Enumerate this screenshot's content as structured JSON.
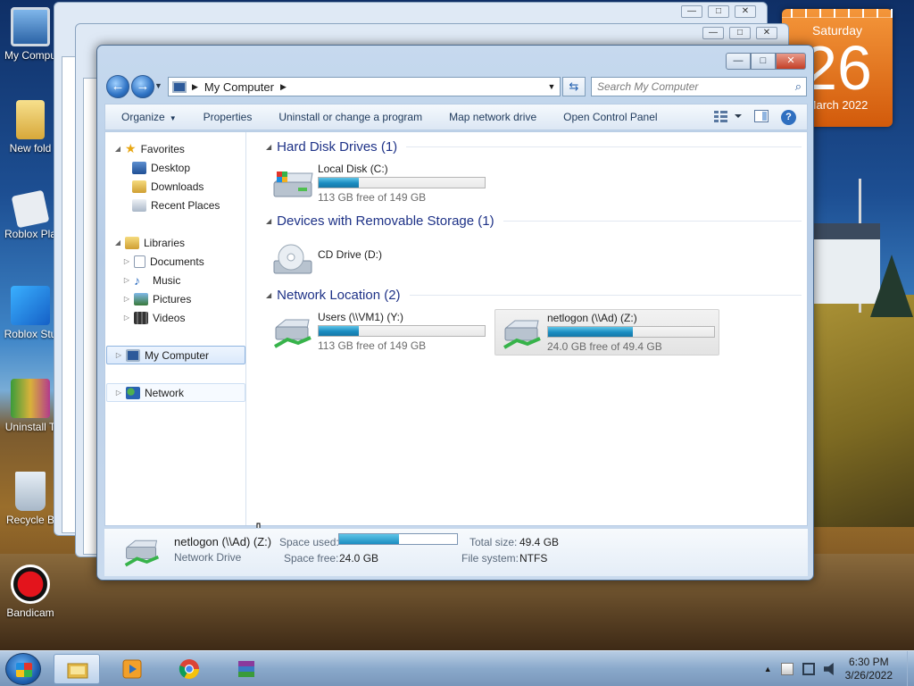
{
  "desktop": {
    "icons": [
      {
        "label": "My Compu",
        "icon": "computer-icon"
      },
      {
        "label": "New fold",
        "icon": "folder-icon"
      },
      {
        "label": "Roblox Pla",
        "icon": "roblox-icon"
      },
      {
        "label": "Roblox Stu",
        "icon": "roblox-studio-icon"
      },
      {
        "label": "Uninstall T",
        "icon": "uninstall-tool-icon"
      },
      {
        "label": "Recycle B",
        "icon": "recycle-bin-icon"
      },
      {
        "label": "Bandicam",
        "icon": "bandicam-icon"
      }
    ],
    "calendar": {
      "weekday": "Saturday",
      "day": "26",
      "month_year": "March 2022"
    }
  },
  "window": {
    "controls": {
      "minimize": "—",
      "maximize": "□",
      "close": "✕"
    },
    "address": {
      "path": "My Computer"
    },
    "search": {
      "placeholder": "Search My Computer"
    },
    "toolbar": {
      "organize": "Organize",
      "properties": "Properties",
      "uninstall": "Uninstall or change a program",
      "map_drive": "Map network drive",
      "control_panel": "Open Control Panel"
    },
    "nav": {
      "favorites": "Favorites",
      "desktop": "Desktop",
      "downloads": "Downloads",
      "recent_places": "Recent Places",
      "libraries": "Libraries",
      "documents": "Documents",
      "music": "Music",
      "pictures": "Pictures",
      "videos": "Videos",
      "my_computer": "My Computer",
      "network": "Network"
    },
    "groups": {
      "hdd": "Hard Disk Drives (1)",
      "removable": "Devices with Removable Storage (1)",
      "network": "Network Location (2)"
    },
    "drives": {
      "local_c": {
        "name": "Local Disk (C:)",
        "free": "113 GB free of 149 GB",
        "used_fraction": 0.24
      },
      "cd_d": {
        "name": "CD Drive (D:)"
      },
      "users_y": {
        "name": "Users (\\\\VM1) (Y:)",
        "free": "113 GB free of 149 GB",
        "used_fraction": 0.24
      },
      "netlogon_z": {
        "name": "netlogon (\\\\Ad) (Z:)",
        "free": "24.0 GB free of 49.4 GB",
        "used_fraction": 0.51
      }
    },
    "details": {
      "name": "netlogon (\\\\Ad) (Z:)",
      "type": "Network Drive",
      "space_used_label": "Space used:",
      "space_free_label": "Space free:",
      "space_free": "24.0 GB",
      "total_size_label": "Total size:",
      "total_size": "49.4 GB",
      "fs_label": "File system:",
      "fs": "NTFS",
      "used_fraction": 0.51
    }
  },
  "taskbar": {
    "apps": [
      "windows-explorer-icon",
      "media-player-icon",
      "chrome-icon",
      "winrar-icon"
    ],
    "clock": {
      "time": "6:30 PM",
      "date": "3/26/2022"
    },
    "tray_expand": "▲"
  }
}
